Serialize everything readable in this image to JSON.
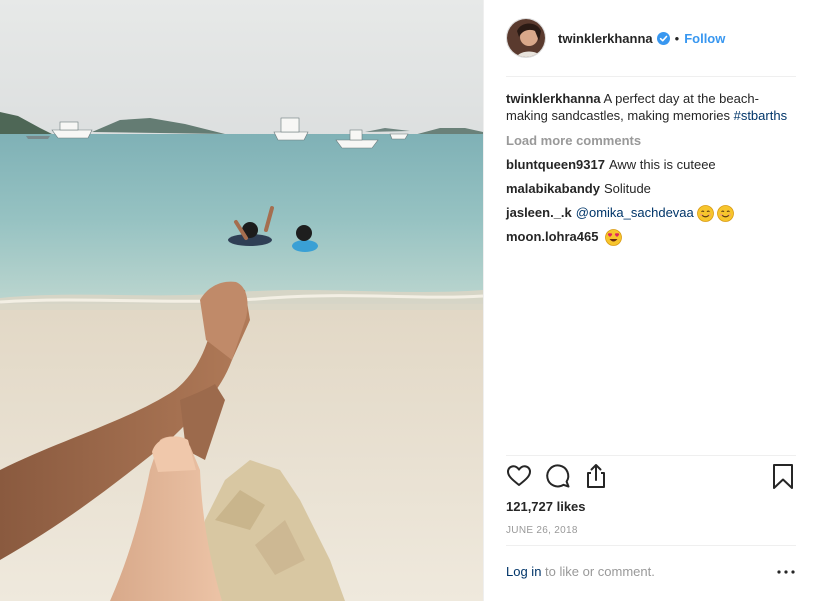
{
  "post": {
    "username": "twinklerkhanna",
    "verified": true,
    "separator": "•",
    "follow_label": "Follow",
    "caption": {
      "username": "twinklerkhanna",
      "text": " A perfect day at the beach- making sandcastles, making memories ",
      "hashtag": "#stbarths"
    },
    "load_more_label": "Load more comments",
    "comments": [
      {
        "username": "bluntqueen9317",
        "text": "Aww this is cuteee",
        "mention": "",
        "emojis": []
      },
      {
        "username": "malabikabandy",
        "text": "Solitude",
        "mention": "",
        "emojis": []
      },
      {
        "username": "jasleen._.k",
        "text": "",
        "mention": "@omika_sachdevaa",
        "emojis": [
          "smiling-face",
          "smiling-face"
        ]
      },
      {
        "username": "moon.lohra465",
        "text": "",
        "mention": "",
        "emojis": [
          "heart-eyes-face"
        ]
      }
    ],
    "icons": [
      "heart-icon",
      "comment-icon",
      "share-icon",
      "bookmark-icon",
      "more-options-icon"
    ],
    "likes": "121,727 likes",
    "date": "JUNE 26, 2018",
    "footer": {
      "login_label": "Log in",
      "login_suffix": " to like or comment."
    },
    "colors": {
      "link_blue": "#3897f0",
      "hashtag_blue": "#003569",
      "muted_gray": "#999999",
      "text": "#262626",
      "divider": "#efefef"
    }
  }
}
